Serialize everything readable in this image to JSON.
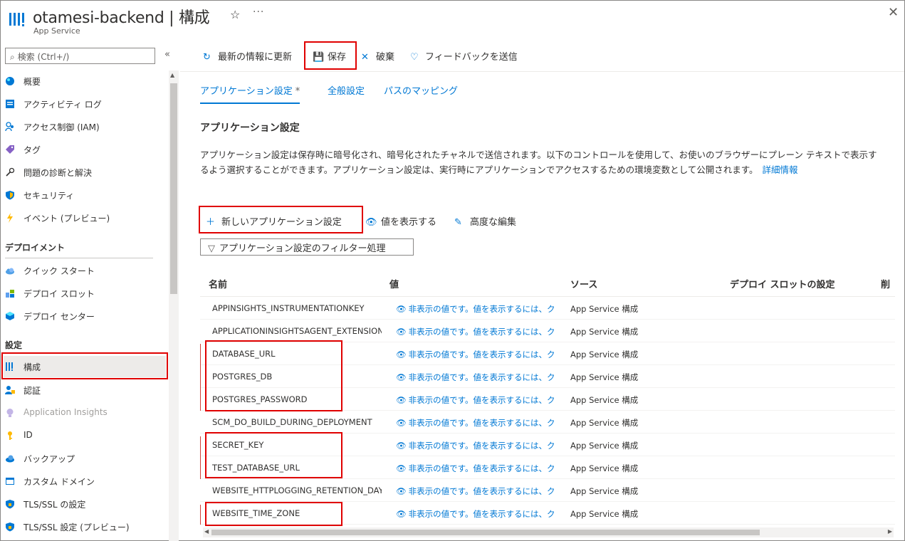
{
  "header": {
    "title": "otamesi-backend | 構成",
    "subtitle": "App Service",
    "favorite_glyph": "☆",
    "more_glyph": "···",
    "close_glyph": "✕"
  },
  "sidebar": {
    "search_placeholder": "検索 (Ctrl+/)",
    "collapse_glyph": "«",
    "items_top": [
      {
        "label": "概要",
        "icon": "globe-icon"
      },
      {
        "label": "アクティビティ ログ",
        "icon": "log-icon"
      },
      {
        "label": "アクセス制御 (IAM)",
        "icon": "people-icon"
      },
      {
        "label": "タグ",
        "icon": "tag-icon"
      },
      {
        "label": "問題の診断と解決",
        "icon": "wrench-icon"
      },
      {
        "label": "セキュリティ",
        "icon": "shield-icon"
      },
      {
        "label": "イベント (プレビュー)",
        "icon": "lightning-icon"
      }
    ],
    "section_deploy": "デプロイメント",
    "items_deploy": [
      {
        "label": "クイック スタート",
        "icon": "cloud-icon"
      },
      {
        "label": "デプロイ スロット",
        "icon": "slots-icon"
      },
      {
        "label": "デプロイ センター",
        "icon": "cube-icon"
      }
    ],
    "section_settings": "設定",
    "items_settings": [
      {
        "label": "構成",
        "icon": "config-icon"
      },
      {
        "label": "認証",
        "icon": "auth-icon"
      },
      {
        "label": "Application Insights",
        "icon": "bulb-icon"
      },
      {
        "label": "ID",
        "icon": "key-icon"
      },
      {
        "label": "バックアップ",
        "icon": "backup-icon"
      },
      {
        "label": "カスタム ドメイン",
        "icon": "domain-icon"
      },
      {
        "label": "TLS/SSL の設定",
        "icon": "tls-shield-icon"
      },
      {
        "label": "TLS/SSL 設定 (プレビュー)",
        "icon": "tls-shield-icon"
      }
    ]
  },
  "toolbar": {
    "refresh_label": "最新の情報に更新",
    "save_label": "保存",
    "discard_label": "破棄",
    "feedback_label": "フィードバックを送信"
  },
  "tabs": {
    "app_settings": "アプリケーション設定",
    "modified_mark": "*",
    "general": "全般設定",
    "path_mapping": "パスのマッピング"
  },
  "section": {
    "title": "アプリケーション設定",
    "description": "アプリケーション設定は保存時に暗号化され、暗号化されたチャネルで送信されます。以下のコントロールを使用して、お使いのブラウザーにプレーン テキストで表示するよう選択することができます。アプリケーション設定は、実行時にアプリケーションでアクセスするための環境変数として公開されます。",
    "learn_more": "詳細情報"
  },
  "actions": {
    "new_setting": "新しいアプリケーション設定",
    "show_values": "値を表示する",
    "advanced_edit": "高度な編集",
    "filter": "アプリケーション設定のフィルター処理"
  },
  "table": {
    "headers": {
      "name": "名前",
      "value": "値",
      "source": "ソース",
      "slot": "デプロイ スロットの設定",
      "delete": "削"
    },
    "hidden_value_text": "非表示の値です。値を表示するには、ク",
    "rows": [
      {
        "name": "APPINSIGHTS_INSTRUMENTATIONKEY",
        "source": "App Service 構成"
      },
      {
        "name": "APPLICATIONINSIGHTSAGENT_EXTENSION_E",
        "source": "App Service 構成"
      },
      {
        "name": "DATABASE_URL",
        "source": "App Service 構成"
      },
      {
        "name": "POSTGRES_DB",
        "source": "App Service 構成"
      },
      {
        "name": "POSTGRES_PASSWORD",
        "source": "App Service 構成"
      },
      {
        "name": "SCM_DO_BUILD_DURING_DEPLOYMENT",
        "source": "App Service 構成"
      },
      {
        "name": "SECRET_KEY",
        "source": "App Service 構成"
      },
      {
        "name": "TEST_DATABASE_URL",
        "source": "App Service 構成"
      },
      {
        "name": "WEBSITE_HTTPLOGGING_RETENTION_DAYS",
        "source": "App Service 構成"
      },
      {
        "name": "WEBSITE_TIME_ZONE",
        "source": "App Service 構成"
      }
    ]
  },
  "colors": {
    "accent": "#0078d4",
    "highlight": "#e00000",
    "active_bg": "#edebe9"
  }
}
